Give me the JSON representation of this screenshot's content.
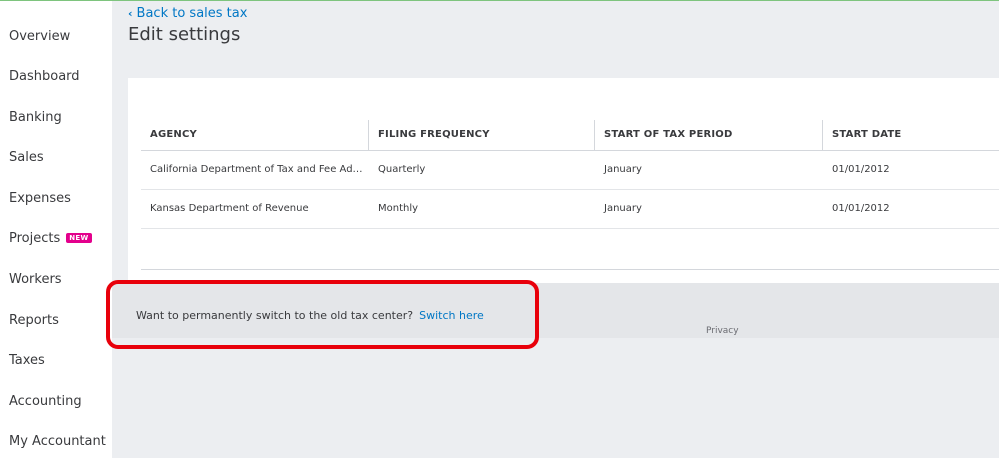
{
  "sidebar": {
    "items": [
      {
        "label": "Overview"
      },
      {
        "label": "Dashboard"
      },
      {
        "label": "Banking"
      },
      {
        "label": "Sales"
      },
      {
        "label": "Expenses"
      },
      {
        "label": "Projects",
        "badge": "NEW"
      },
      {
        "label": "Workers"
      },
      {
        "label": "Reports"
      },
      {
        "label": "Taxes"
      },
      {
        "label": "Accounting"
      },
      {
        "label": "My Accountant"
      }
    ]
  },
  "header": {
    "back_link": "Back to sales tax",
    "title": "Edit settings"
  },
  "table": {
    "columns": [
      "AGENCY",
      "FILING FREQUENCY",
      "START OF TAX PERIOD",
      "START DATE"
    ],
    "rows": [
      [
        "California Department of Tax and Fee Administration",
        "Quarterly",
        "January",
        "01/01/2012"
      ],
      [
        "Kansas Department of Revenue",
        "Monthly",
        "January",
        "01/01/2012"
      ]
    ]
  },
  "footer": {
    "switch_prompt": "Want to permanently switch to the old tax center?",
    "switch_link": "Switch here",
    "privacy": "Privacy"
  },
  "colors": {
    "link": "#0077c5",
    "badge": "#e3008c",
    "highlight": "#e8000b"
  }
}
